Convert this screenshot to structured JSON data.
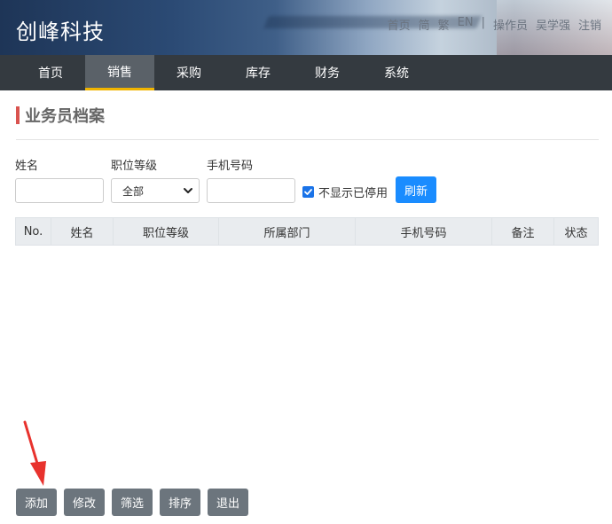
{
  "header": {
    "logo": "创峰科技",
    "links": [
      "首页",
      "简",
      "繁",
      "EN",
      "|",
      "操作员",
      "吴学强",
      "注销"
    ]
  },
  "nav": {
    "tabs": [
      {
        "label": "首页",
        "active": false
      },
      {
        "label": "销售",
        "active": true
      },
      {
        "label": "采购",
        "active": false
      },
      {
        "label": "库存",
        "active": false
      },
      {
        "label": "财务",
        "active": false
      },
      {
        "label": "系统",
        "active": false
      }
    ]
  },
  "page": {
    "title": "业务员档案"
  },
  "filters": {
    "name_label": "姓名",
    "name_value": "",
    "level_label": "职位等级",
    "level_selected": "全部",
    "phone_label": "手机号码",
    "phone_value": "",
    "hide_disabled_label": "不显示已停用",
    "hide_disabled_checked": true,
    "refresh_label": "刷新"
  },
  "table": {
    "columns": [
      "No.",
      "姓名",
      "职位等级",
      "所属部门",
      "手机号码",
      "备注",
      "状态"
    ],
    "rows": []
  },
  "actions": {
    "add": "添加",
    "edit": "修改",
    "filter": "筛选",
    "sort": "排序",
    "exit": "退出"
  },
  "colors": {
    "nav_bg": "#343a40",
    "active_tab_underline": "#f0b400",
    "primary": "#1a8cff",
    "secondary_button": "#6c757d",
    "title_accent": "#d9534f",
    "annotation_arrow": "#e8322d"
  }
}
